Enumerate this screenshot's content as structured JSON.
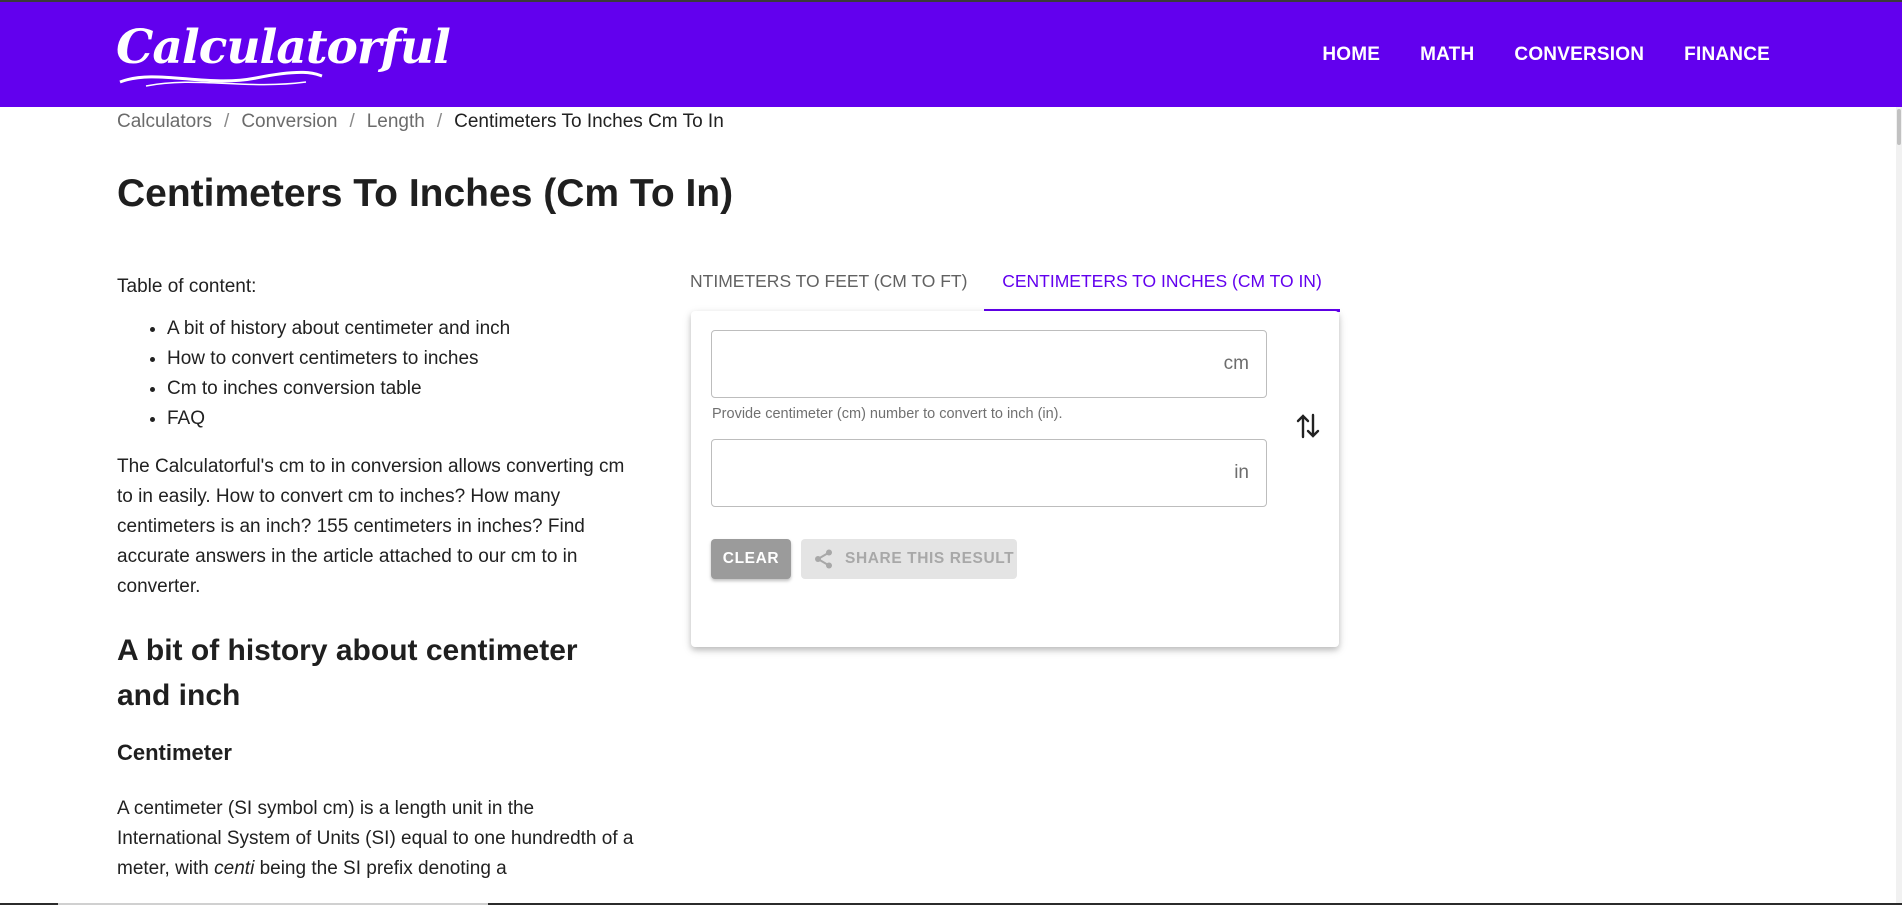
{
  "brand": {
    "logo_text": "Calculatorful"
  },
  "nav": {
    "items": [
      {
        "label": "HOME"
      },
      {
        "label": "MATH"
      },
      {
        "label": "CONVERSION"
      },
      {
        "label": "FINANCE"
      }
    ]
  },
  "breadcrumb": {
    "items": [
      "Calculators",
      "Conversion",
      "Length"
    ],
    "separator": "/",
    "current": "Centimeters To Inches Cm To In"
  },
  "page": {
    "title": "Centimeters To Inches (Cm To In)"
  },
  "content": {
    "toc_title": "Table of content:",
    "toc": [
      "A bit of history about centimeter and inch",
      "How to convert centimeters to inches",
      "Cm to inches conversion table",
      "FAQ"
    ],
    "intro": "The Calculatorful's cm to in conversion allows converting cm to in easily. How to convert cm to inches? How many centimeters is an inch? 155 centimeters in inches? Find accurate answers in the article attached to our cm to in converter.",
    "h2": "A bit of history about centimeter and inch",
    "h3": "Centimeter",
    "body_before": "A centimeter (SI symbol cm) is a length unit in the International System of Units (SI) equal to one hundredth of a meter, with ",
    "body_em": "centi",
    "body_after": " being the SI prefix denoting a"
  },
  "converter": {
    "tabs": [
      {
        "label": "NTIMETERS TO FEET (CM TO FT)",
        "active": false
      },
      {
        "label": "CENTIMETERS TO INCHES (CM TO IN)",
        "active": true
      }
    ],
    "from": {
      "value": "",
      "unit": "cm",
      "hint": "Provide centimeter (cm) number to convert to inch (in)."
    },
    "to": {
      "value": "",
      "unit": "in"
    },
    "clear_label": "CLEAR",
    "share_label": "SHARE THIS RESULT",
    "swap_icon": "swap-vertical-icon",
    "share_icon": "share-icon"
  },
  "colors": {
    "brand": "#6200ee",
    "text": "#212121",
    "muted": "#6b6b6b"
  }
}
